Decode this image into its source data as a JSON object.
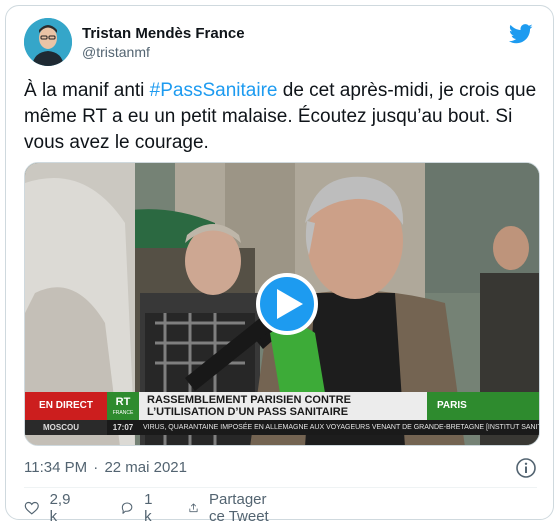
{
  "author": {
    "display_name": "Tristan Mendès France",
    "handle": "@tristanmf",
    "avatar_icon": "person-avatar"
  },
  "brand": {
    "icon": "twitter-bird-icon",
    "color": "#1d9bf0"
  },
  "tweet": {
    "text_before": "À la manif anti ",
    "hashtag": "#PassSanitaire",
    "text_after": " de cet après-midi, je crois que même RT a eu un petit malaise. Écoutez jusqu’au bout. Si vous avez le courage."
  },
  "video": {
    "play_icon": "play-icon",
    "banner": {
      "live_label": "EN DIRECT",
      "logo_text": "RT",
      "logo_sub": "FRANCE",
      "headline_line1": "RASSEMBLEMENT PARISIEN CONTRE",
      "headline_line2": "L’UTILISATION D’UN PASS SANITAIRE",
      "city": "PARIS",
      "ticker_city": "MOSCOU",
      "ticker_time": "17:07",
      "ticker_text": "VIRUS, QUARANTAINE IMPOSÉE EN ALLEMAGNE AUX VOYAGEURS VENANT DE GRANDE-BRETAGNE [INSTITUT SANITAIRE]"
    }
  },
  "meta": {
    "time": "11:34 PM",
    "separator": "·",
    "date": "22 mai 2021",
    "info_icon": "info-icon"
  },
  "actions": {
    "likes": "2,9 k",
    "replies": "1 k",
    "share_label": "Partager ce Tweet"
  }
}
